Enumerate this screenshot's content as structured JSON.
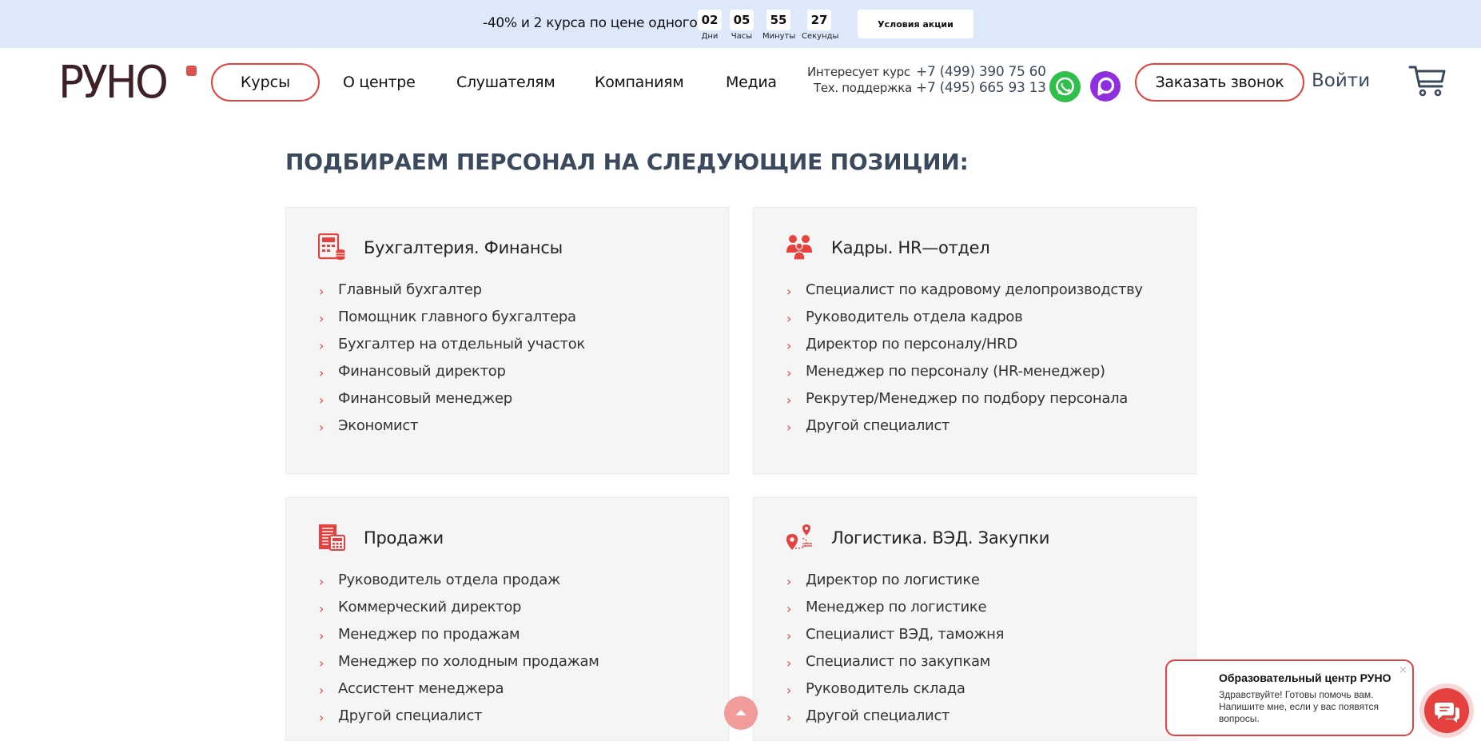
{
  "promo": {
    "text": "-40% и 2 курса по цене одного",
    "timer": [
      {
        "value": "02",
        "label": "Дни"
      },
      {
        "value": "05",
        "label": "Часы"
      },
      {
        "value": "55",
        "label": "Минуты"
      },
      {
        "value": "27",
        "label": "Секунды"
      }
    ],
    "button_label": "Условия акции"
  },
  "header": {
    "logo_text": "РУНО",
    "nav": [
      "Курсы",
      "О центре",
      "Слушателям",
      "Компаниям",
      "Медиа"
    ],
    "contacts": [
      {
        "label": "Интересует курс",
        "phone": "+7 (499) 390 75 60"
      },
      {
        "label": "Тех. поддержка",
        "phone": "+7 (495) 665 93 13"
      }
    ],
    "call_button": "Заказать звонок",
    "login": "Войти"
  },
  "section": {
    "title": "ПОДБИРАЕМ ПЕРСОНАЛ НА СЛЕДУЮЩИЕ ПОЗИЦИИ:",
    "cards": [
      {
        "title": "Бухгалтерия. Финансы",
        "icon": "calculator-icon",
        "items": [
          "Главный бухгалтер",
          "Помощник главного бухгалтера",
          "Бухгалтер на отдельный участок",
          "Финансовый директор",
          "Финансовый менеджер",
          "Экономист"
        ]
      },
      {
        "title": "Кадры. HR—отдел",
        "icon": "people-icon",
        "items": [
          "Специалист по кадровому делопроизводству",
          "Руководитель отдела кадров",
          "Директор по персоналу/HRD",
          "Менеджер по персоналу (HR-менеджер)",
          "Рекрутер/Менеджер по подбору персонала",
          "Другой специалист"
        ]
      },
      {
        "title": "Продажи",
        "icon": "document-calculator-icon",
        "items": [
          "Руководитель отдела продаж",
          "Коммерческий директор",
          "Менеджер по продажам",
          "Менеджер по холодным продажам",
          "Ассистент менеджера",
          "Другой специалист"
        ]
      },
      {
        "title": "Логистика. ВЭД. Закупки",
        "icon": "route-pin-icon",
        "items": [
          "Директор по логистике",
          "Менеджер по логистике",
          "Специалист ВЭД, таможня",
          "Специалист по закупкам",
          "Руководитель склада",
          "Другой специалист"
        ]
      }
    ]
  },
  "chat": {
    "title": "Образовательный центр РУНО",
    "message": "Здравствуйте! Готовы помочь вам. Напишите мне, если у вас появятся вопросы.",
    "close": "×"
  },
  "colors": {
    "accent": "#e5423f",
    "promo_bg": "#dde9fb",
    "heading": "#3a4a5c",
    "card_bg": "#f5f5f5",
    "whatsapp": "#2fbf4a",
    "max": "#8f2fe0"
  }
}
